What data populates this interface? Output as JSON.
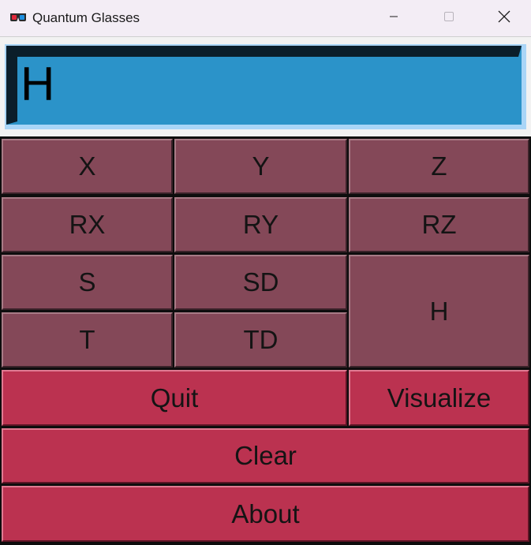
{
  "window": {
    "title": "Quantum Glasses",
    "icon": "3d-glasses-icon",
    "controls": {
      "minimize": "minimize-icon",
      "maximize": "maximize-icon",
      "close": "close-icon"
    }
  },
  "display": {
    "value": "H"
  },
  "gates": {
    "x": "X",
    "y": "Y",
    "z": "Z",
    "rx": "RX",
    "ry": "RY",
    "rz": "RZ",
    "s": "S",
    "sd": "SD",
    "h": "H",
    "t": "T",
    "td": "TD"
  },
  "actions": {
    "quit": "Quit",
    "visualize": "Visualize",
    "clear": "Clear",
    "about": "About"
  },
  "colors": {
    "gate_button": "#844858",
    "action_button": "#bb3250",
    "display_background": "#2b93c9",
    "display_border": "#a9d5f7"
  }
}
